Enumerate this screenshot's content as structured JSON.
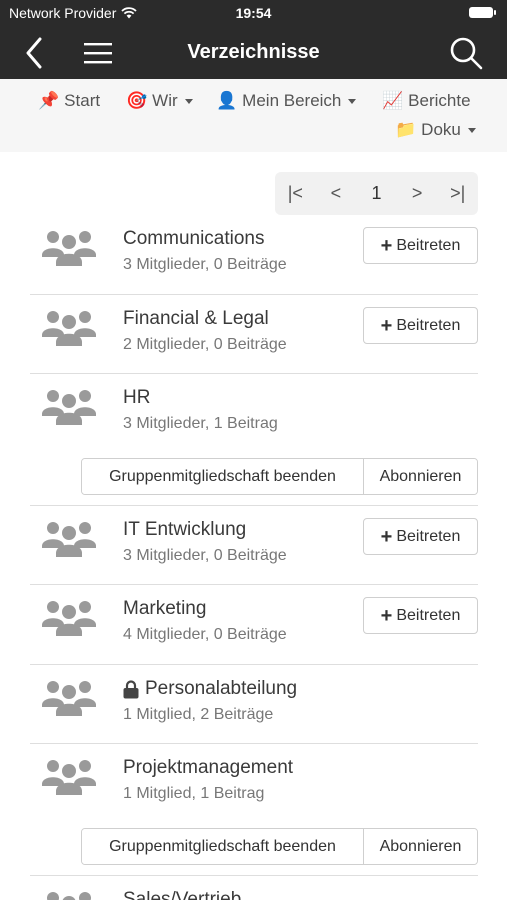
{
  "status": {
    "carrier": "Network Provider",
    "time": "19:54"
  },
  "nav": {
    "title": "Verzeichnisse",
    "back_icon": "back-chevron-icon",
    "menu_icon": "hamburger-menu-icon",
    "search_icon": "search-icon"
  },
  "menu": {
    "items": [
      {
        "label": "Start",
        "icon": "pushpin-icon",
        "emoji": "📌",
        "dropdown": false
      },
      {
        "label": "Wir",
        "icon": "target-icon",
        "emoji": "🎯",
        "dropdown": true
      },
      {
        "label": "Mein Bereich",
        "icon": "user-icon",
        "emoji": "👤",
        "dropdown": true
      },
      {
        "label": "Berichte",
        "icon": "chart-increasing-icon",
        "emoji": "📈",
        "dropdown": false
      },
      {
        "label": "Doku",
        "icon": "folder-icon",
        "emoji": "📁",
        "dropdown": true
      }
    ]
  },
  "pager": {
    "first": "|<",
    "prev": "<",
    "current": "1",
    "next": ">",
    "last": ">|"
  },
  "buttons": {
    "join": "Beitreten",
    "leave": "Gruppenmitgliedschaft beenden",
    "subscribe": "Abonnieren"
  },
  "groups": [
    {
      "name": "Communications",
      "meta": "3 Mitglieder, 0 Beiträge",
      "state": "join"
    },
    {
      "name": "Financial & Legal",
      "meta": "2 Mitglieder, 0 Beiträge",
      "state": "join"
    },
    {
      "name": "HR",
      "meta": "3 Mitglieder, 1 Beitrag",
      "state": "member"
    },
    {
      "name": "IT Entwicklung",
      "meta": "3 Mitglieder, 0 Beiträge",
      "state": "join"
    },
    {
      "name": "Marketing",
      "meta": "4 Mitglieder, 0 Beiträge",
      "state": "join"
    },
    {
      "name": "Personalabteilung",
      "meta": "1 Mitglied, 2 Beiträge",
      "state": "locked"
    },
    {
      "name": "Projektmanagement",
      "meta": "1 Mitglied, 1 Beitrag",
      "state": "member"
    },
    {
      "name": "Sales/Vertrieb",
      "meta": "",
      "state": "partial"
    }
  ],
  "colors": {
    "header_bg": "#2b2b2b",
    "menu_bg": "#f6f6f6",
    "icon_gray": "#999999",
    "text": "#3a3a3a"
  }
}
